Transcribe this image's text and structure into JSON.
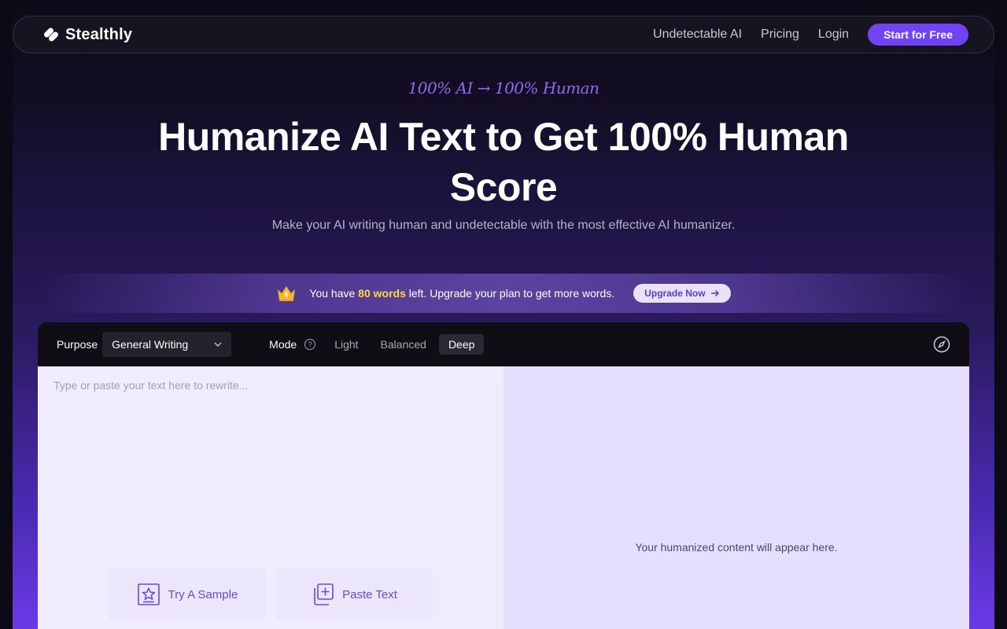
{
  "nav": {
    "logo_text": "Stealthly",
    "links": [
      "Undetectable AI",
      "Pricing",
      "Login"
    ],
    "cta": "Start for Free"
  },
  "hero": {
    "tagline": "100% AI → 100% Human",
    "title": "Humanize AI Text to Get 100% Human Score",
    "subtitle": "Make your AI writing human and undetectable with the most effective AI humanizer."
  },
  "upgrade_bar": {
    "prefix": "You have ",
    "words": "80 words",
    "suffix": " left. Upgrade your plan to get more words.",
    "button": "Upgrade Now"
  },
  "toolbar": {
    "purpose_label": "Purpose",
    "purpose_value": "General Writing",
    "mode_label": "Mode",
    "modes": [
      "Light",
      "Balanced",
      "Deep"
    ],
    "active_mode": "Deep"
  },
  "editor": {
    "placeholder": "Type or paste your text here to rewrite...",
    "sample_button": "Try A Sample",
    "paste_button": "Paste Text",
    "output_hint": "Your humanized content will appear here."
  },
  "colors": {
    "accent": "#7044f4",
    "highlight": "#ffd83a",
    "tagline": "#8a6cf0"
  }
}
